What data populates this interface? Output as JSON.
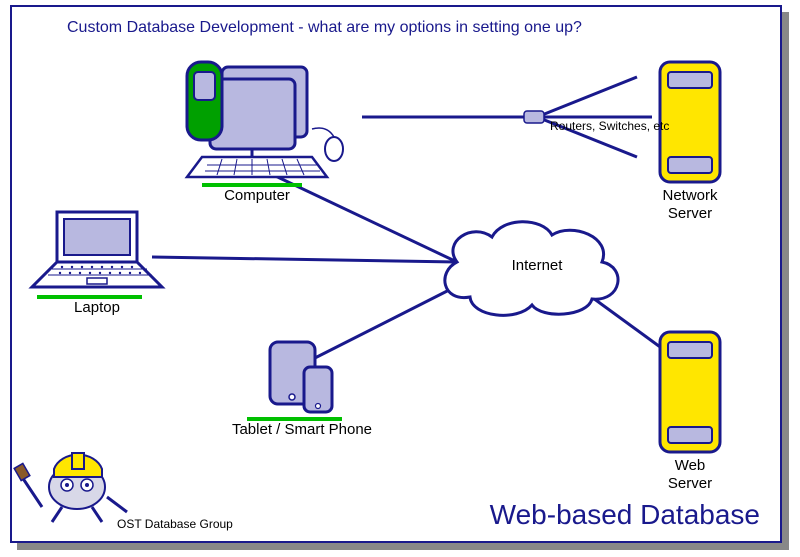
{
  "title": "Custom Database Development - what are my options in setting one up?",
  "big_title": "Web-based Database",
  "footer": "OST Database Group",
  "nodes": {
    "computer": {
      "label": "Computer"
    },
    "laptop": {
      "label": "Laptop"
    },
    "tablet": {
      "label": "Tablet / Smart Phone"
    },
    "internet": {
      "label": "Internet"
    },
    "routers": {
      "label": "Routers, Switches, etc"
    },
    "network_server": {
      "label": "Network\nServer"
    },
    "web_server": {
      "label": "Web\nServer"
    }
  },
  "colors": {
    "line": "#19198c",
    "fill_purple": "#b8b8e0",
    "fill_yellow": "#ffe600",
    "fill_green": "#00a000",
    "accent_green": "#00c000"
  }
}
